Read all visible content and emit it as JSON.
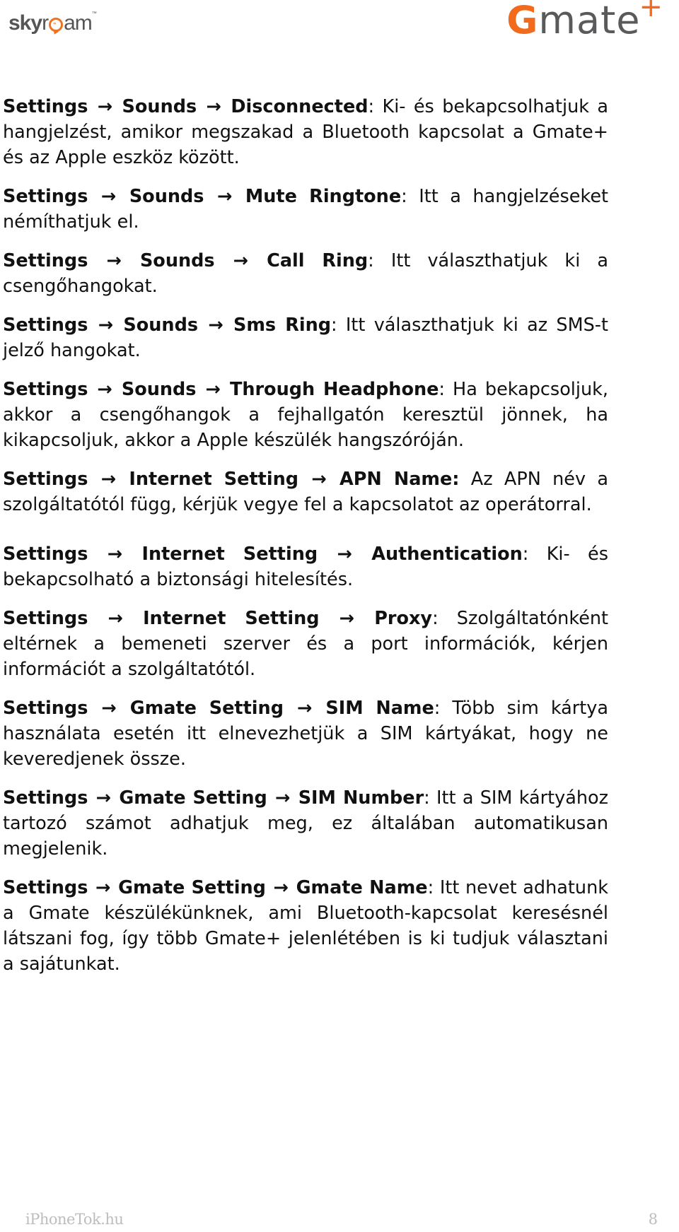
{
  "header": {
    "left_logo": {
      "text_a": "sky",
      "text_b": "r",
      "text_c": "am",
      "tm": "™",
      "dots": "“"
    },
    "right_logo": {
      "g": "G",
      "rest": "mate",
      "plus": "+"
    }
  },
  "arrow": "→",
  "paragraphs": [
    {
      "path": [
        "Settings",
        "Sounds",
        "Disconnected"
      ],
      "sep": ":",
      "text": " Ki- és bekapcsolhatjuk a hangjelzést, amikor megszakad a Bluetooth kapcsolat a Gmate+ és az Apple eszköz között."
    },
    {
      "path": [
        "Settings",
        "Sounds",
        "Mute Ringtone"
      ],
      "sep": ":",
      "text": " Itt a hangjelzéseket némíthatjuk el."
    },
    {
      "path": [
        "Settings",
        "Sounds",
        "Call Ring"
      ],
      "sep": ":",
      "text": " Itt választhatjuk ki a csengőhangokat."
    },
    {
      "path": [
        "Settings",
        "Sounds",
        "Sms Ring"
      ],
      "sep": ":",
      "text": " Itt választhatjuk ki az SMS-t jelző hangokat."
    },
    {
      "path": [
        "Settings",
        "Sounds",
        "Through Headphone"
      ],
      "sep": ":",
      "text": " Ha bekapcsoljuk, akkor a csengőhangok a fejhallgatón keresztül jönnek, ha kikapcsoljuk, akkor a Apple készülék hangszóróján."
    },
    {
      "path": [
        "Settings",
        "Internet Setting",
        "APN Name:"
      ],
      "sep": "",
      "text": " Az APN név a szolgáltatótól függ, kérjük vegye fel a kapcsolatot az operátorral."
    },
    {
      "path": [
        "Settings",
        "Internet Setting",
        "Authentication"
      ],
      "sep": ":",
      "text": " Ki- és bekapcsolható a biztonsági hitelesítés."
    },
    {
      "path": [
        "Settings",
        "Internet Setting",
        "Proxy"
      ],
      "sep": ":",
      "text": " Szolgáltatónként eltérnek a bemeneti szerver és a port információk, kérjen információt a szolgáltatótól."
    },
    {
      "path": [
        "Settings",
        "Gmate Setting",
        "SIM Name"
      ],
      "sep": ":",
      "text": " Több sim kártya használata esetén itt elnevezhetjük a SIM kártyákat, hogy ne keveredjenek össze."
    },
    {
      "path": [
        "Settings",
        "Gmate Setting",
        "SIM Number"
      ],
      "sep": ":",
      "text": " Itt a SIM kártyához tartozó számot adhatjuk meg, ez általában automatikusan megjelenik."
    },
    {
      "path": [
        "Settings",
        "Gmate Setting",
        "Gmate Name"
      ],
      "sep": ":",
      "text": " Itt nevet adhatunk a Gmate készülékünknek, ami Bluetooth-kapcsolat keresésnél látszani fog, így több Gmate+ jelenlétében is ki tudjuk választani a sajátunkat."
    }
  ],
  "footer": {
    "site": "iPhoneTok.hu",
    "page_number": "8"
  }
}
